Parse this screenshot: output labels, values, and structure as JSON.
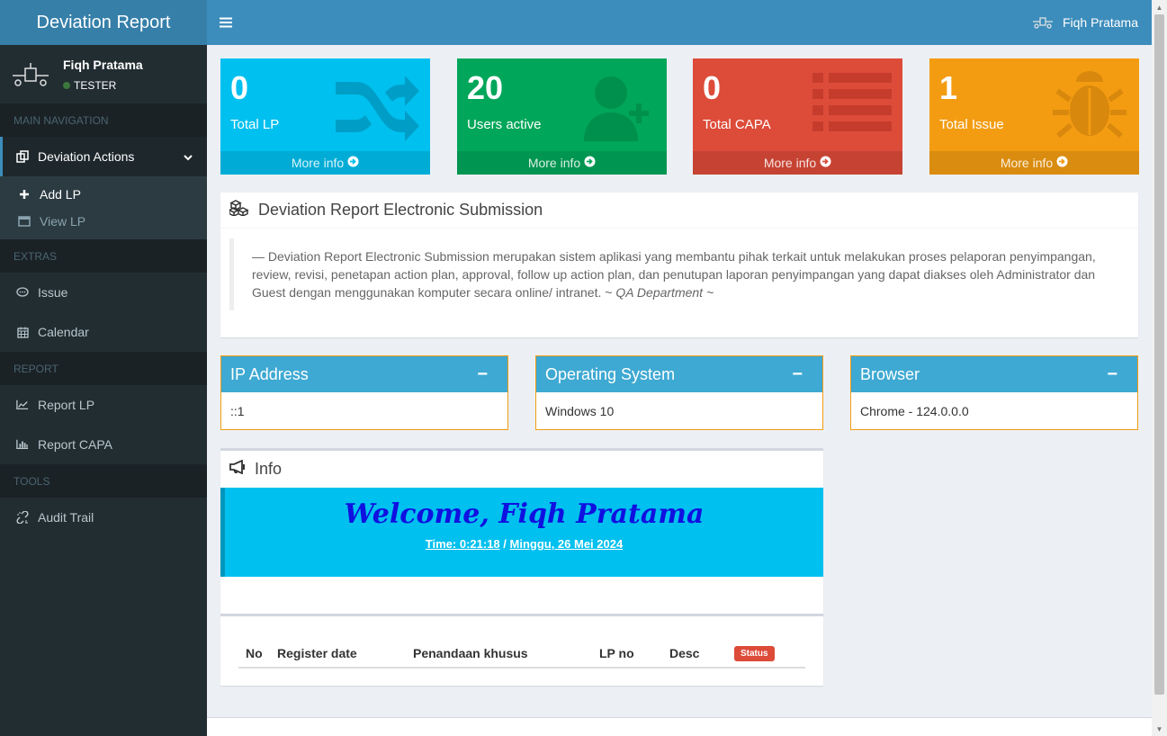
{
  "app": {
    "title": "Deviation Report"
  },
  "user": {
    "name": "Fiqh Pratama",
    "role": "TESTER"
  },
  "sidebar": {
    "headers": [
      "MAIN NAVIGATION",
      "EXTRAS",
      "REPORT",
      "TOOLS"
    ],
    "deviation_actions": "Deviation Actions",
    "sub_items": [
      "Add LP",
      "View LP"
    ],
    "extras": [
      "Issue",
      "Calendar"
    ],
    "report": [
      "Report LP",
      "Report CAPA"
    ],
    "tools": [
      "Audit Trail"
    ]
  },
  "boxes": [
    {
      "value": "0",
      "label": "Total LP",
      "more": "More info",
      "color": "#00c0ef",
      "icon": "shuffle-icon"
    },
    {
      "value": "20",
      "label": "Users active",
      "more": "More info",
      "color": "#00a65a",
      "icon": "user-plus-icon"
    },
    {
      "value": "0",
      "label": "Total CAPA",
      "more": "More info",
      "color": "#dd4b39",
      "icon": "list-icon"
    },
    {
      "value": "1",
      "label": "Total Issue",
      "more": "More info",
      "color": "#f39c12",
      "icon": "bug-icon"
    }
  ],
  "drs": {
    "title": "Deviation Report Electronic Submission",
    "text": "— Deviation Report Electronic Submission merupakan sistem aplikasi yang membantu pihak terkait untuk melakukan proses pelaporan penyimpangan, review, revisi, penetapan action plan, approval, follow up action plan, dan penutupan laporan penyimpangan yang dapat diakses oleh Administrator dan Guest dengan menggunakan komputer secara online/ intranet. ~ ",
    "cite": "QA Department ~"
  },
  "infoboxes": [
    {
      "title": "IP Address",
      "value": "::1"
    },
    {
      "title": "Operating System",
      "value": "Windows 10"
    },
    {
      "title": "Browser",
      "value": "Chrome - 124.0.0.0"
    }
  ],
  "info": {
    "title": "Info",
    "welcome": "Welcome, Fiqh Pratama",
    "time": "Time: 0:21:18",
    "sep": " / ",
    "date": "Minggu, 26 Mei 2024"
  },
  "table": {
    "columns": [
      "No",
      "Register date",
      "Penandaan khusus",
      "LP no",
      "Desc"
    ],
    "status_badge": "Status"
  }
}
